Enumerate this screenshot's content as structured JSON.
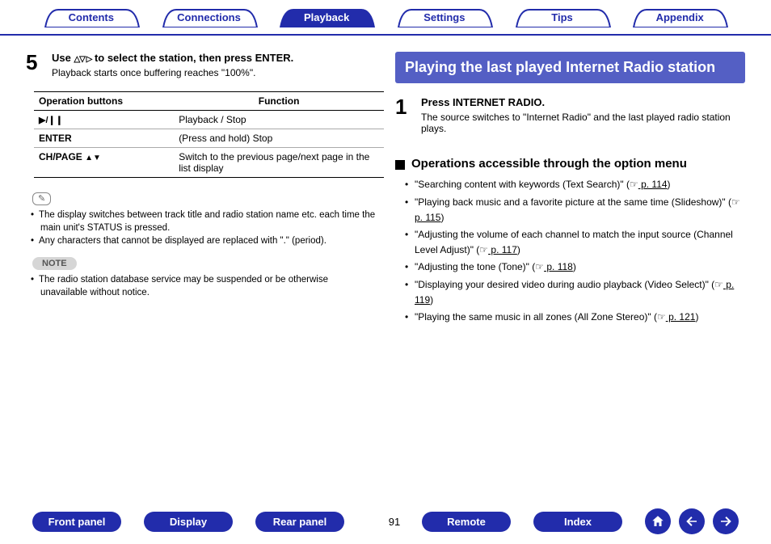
{
  "topTabs": [
    {
      "label": "Contents",
      "active": false
    },
    {
      "label": "Connections",
      "active": false
    },
    {
      "label": "Playback",
      "active": true
    },
    {
      "label": "Settings",
      "active": false
    },
    {
      "label": "Tips",
      "active": false
    },
    {
      "label": "Appendix",
      "active": false
    }
  ],
  "left": {
    "step5": {
      "num": "5",
      "title_pre": "Use ",
      "title_post": " to select the station, then press ENTER.",
      "desc": "Playback starts once buffering reaches \"100%\"."
    },
    "table": {
      "head1": "Operation buttons",
      "head2": "Function",
      "rows": [
        {
          "btn_icon": "play-pause",
          "btn_text": "",
          "func": "Playback / Stop"
        },
        {
          "btn_icon": "",
          "btn_text": "ENTER",
          "func": "(Press and hold) Stop"
        },
        {
          "btn_icon": "ch-page",
          "btn_text": "CH/PAGE ",
          "func": "Switch to the previous page/next page in the list display"
        }
      ]
    },
    "pencil_bullets": [
      "The display switches between track title and radio station name etc. each time the main unit's STATUS is pressed.",
      "Any characters that cannot be displayed are replaced with \".\" (period)."
    ],
    "note_label": "NOTE",
    "note_bullets": [
      "The radio station database service may be suspended or be otherwise unavailable without notice."
    ]
  },
  "right": {
    "banner": "Playing the last played Internet Radio station",
    "step1": {
      "num": "1",
      "title": "Press INTERNET RADIO.",
      "desc": "The source switches to \"Internet Radio\" and the last played radio station plays."
    },
    "opts_heading": "Operations accessible through the option menu",
    "opts": [
      {
        "text": "\"Searching content with keywords (Text Search)\" (",
        "linkicon": true,
        "link": " p. 114",
        "after": ")"
      },
      {
        "text": "\"Playing back music and a favorite picture at the same time (Slideshow)\" (",
        "linkicon": true,
        "link": " p. 115",
        "after": ")"
      },
      {
        "text": "\"Adjusting the volume of each channel to match the input source (Channel Level Adjust)\" (",
        "linkicon": true,
        "link": " p. 117",
        "after": ")"
      },
      {
        "text": "\"Adjusting the tone (Tone)\" (",
        "linkicon": true,
        "link": " p. 118",
        "after": ")"
      },
      {
        "text": "\"Displaying your desired video during audio playback (Video Select)\" (",
        "linkicon": true,
        "link": " p. 119",
        "after": ")"
      },
      {
        "text": "\"Playing the same music in all zones (All Zone Stereo)\" (",
        "linkicon": true,
        "link": " p. 121",
        "after": ")"
      }
    ]
  },
  "pageNumber": "91",
  "bottomPills": [
    "Front panel",
    "Display",
    "Rear panel",
    "Remote",
    "Index"
  ]
}
